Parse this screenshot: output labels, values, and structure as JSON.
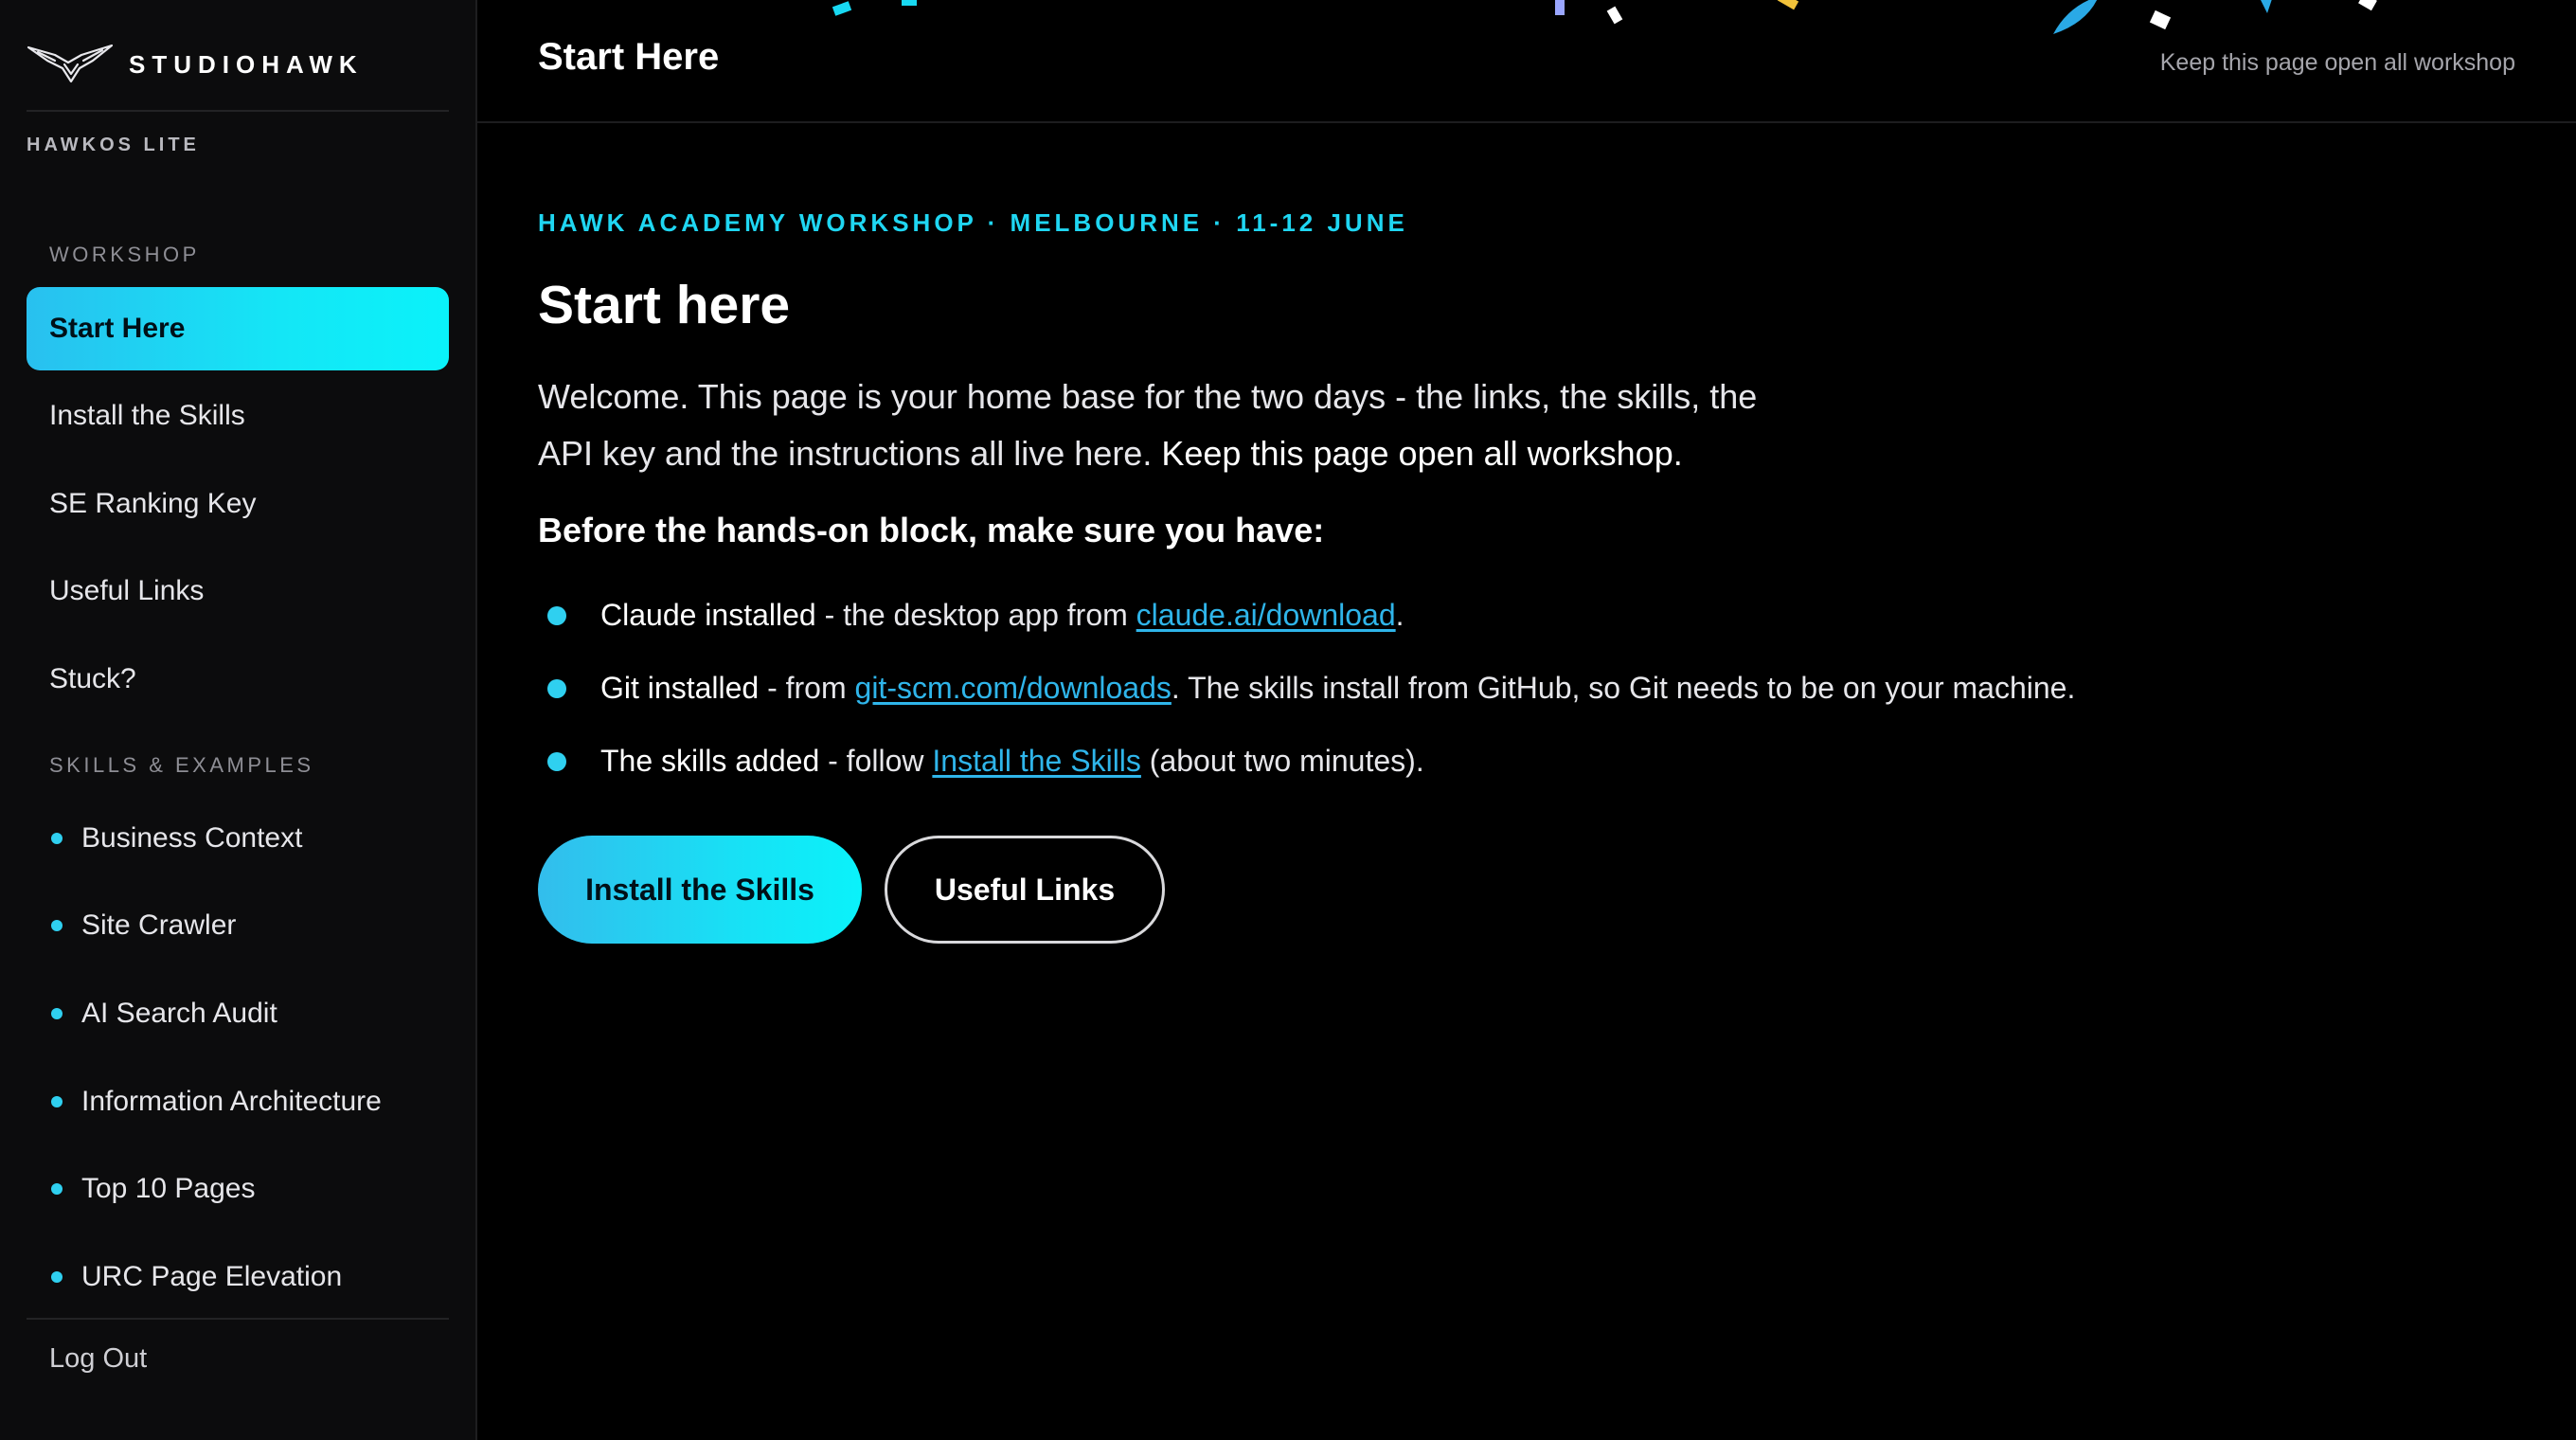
{
  "brand": {
    "name": "STUDIOHAWK",
    "product": "HAWKOS LITE"
  },
  "sidebar": {
    "workshop_label": "WORKSHOP",
    "workshop_items": [
      {
        "label": "Start Here",
        "active": true
      },
      {
        "label": "Install the Skills",
        "active": false
      },
      {
        "label": "SE Ranking Key",
        "active": false
      },
      {
        "label": "Useful Links",
        "active": false
      },
      {
        "label": "Stuck?",
        "active": false
      }
    ],
    "skills_label": "SKILLS & EXAMPLES",
    "skill_items": [
      {
        "label": "Business Context"
      },
      {
        "label": "Site Crawler"
      },
      {
        "label": "AI Search Audit"
      },
      {
        "label": "Information Architecture"
      },
      {
        "label": "Top 10 Pages"
      },
      {
        "label": "URC Page Elevation"
      }
    ],
    "logout_label": "Log Out"
  },
  "header": {
    "title": "Start Here",
    "note": "Keep this page open all workshop"
  },
  "main": {
    "eyebrow": "HAWK ACADEMY WORKSHOP · MELBOURNE · 11-12 JUNE",
    "heading": "Start here",
    "intro_text": "Welcome. This page is your home base for the two days - the links, the skills, the API key and the instructions all live here.",
    "intro_strong": "Keep this page open all workshop.",
    "checklist_title": "Before the hands-on block, make sure you have:",
    "checklist": [
      {
        "lead": "Claude installed",
        "pre": " - the desktop app from ",
        "link": "claude.ai/download",
        "post": "."
      },
      {
        "lead": "Git installed",
        "pre": " - from ",
        "link": "git-scm.com/downloads",
        "post": ". The skills install from GitHub, so Git needs to be on your machine."
      },
      {
        "lead": "The skills added",
        "pre": " - follow ",
        "link": "Install the Skills",
        "post": " (about two minutes)."
      }
    ],
    "buttons": {
      "primary": "Install the Skills",
      "secondary": "Useful Links"
    }
  },
  "colors": {
    "accent": "#1fd6f2",
    "accent_gradient_start": "#29c0ef",
    "accent_gradient_end": "#0af2fa",
    "link": "#2fb5ea",
    "sidebar_bg": "#0c0c0d",
    "page_bg": "#000000"
  },
  "icons": {
    "brand_logo": "hawk-logo-icon",
    "nav_bullet": "bullet-dot-icon",
    "checklist_bullet": "bullet-dot-icon"
  }
}
